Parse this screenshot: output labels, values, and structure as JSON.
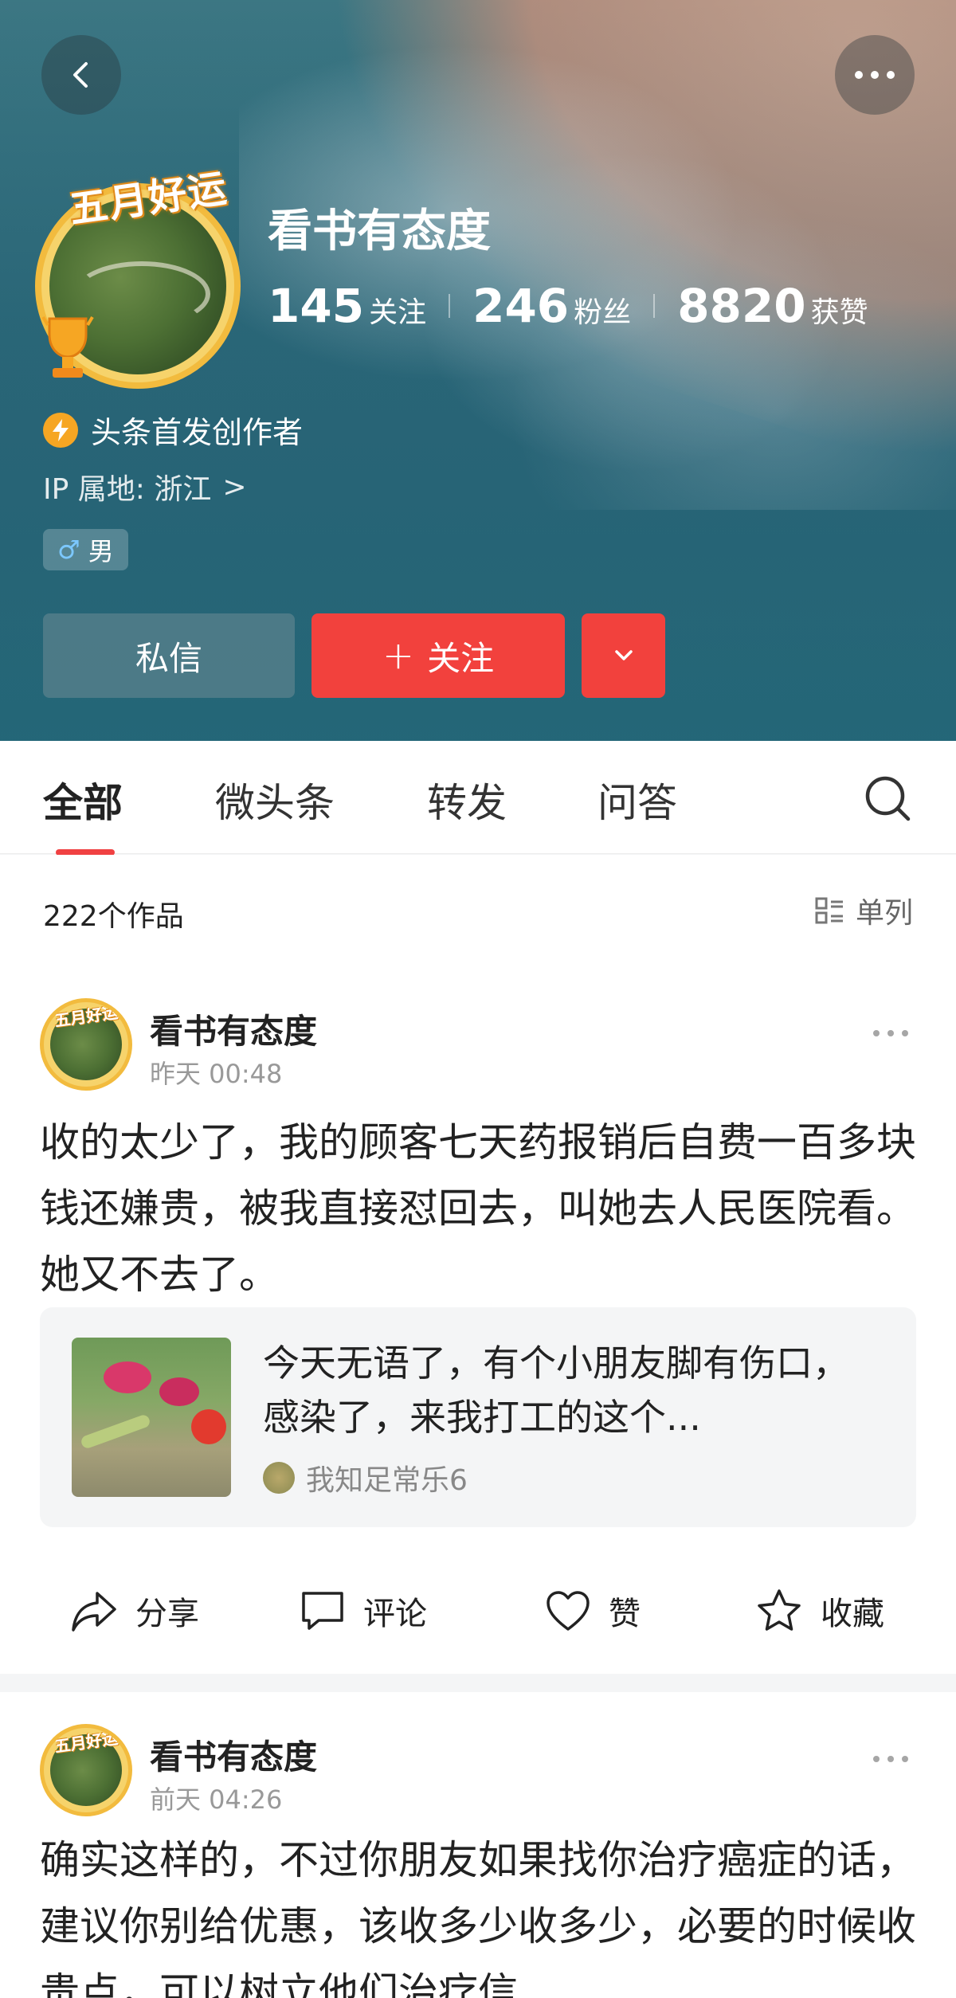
{
  "header": {
    "back_icon": "back-arrow-icon",
    "more_icon": "more-dots-icon",
    "avatar_frame_text": "五月好运",
    "name": "看书有态度",
    "stats": [
      {
        "num": "145",
        "label": "关注"
      },
      {
        "num": "246",
        "label": "粉丝"
      },
      {
        "num": "8820",
        "label": "获赞"
      }
    ],
    "badge_text": "头条首发创作者",
    "ip_text": "IP 属地: 浙江",
    "ip_chevron": ">",
    "gender_icon": "♂",
    "gender_text": "男",
    "message_label": "私信",
    "follow_plus": "+",
    "follow_label": "关注"
  },
  "tabs": {
    "items": [
      {
        "label": "全部",
        "active": true
      },
      {
        "label": "微头条",
        "active": false
      },
      {
        "label": "转发",
        "active": false
      },
      {
        "label": "问答",
        "active": false
      }
    ],
    "accent_color": "#f04142"
  },
  "list_meta": {
    "count_text": "222个作品",
    "layout_label": "单列"
  },
  "posts": [
    {
      "avatar_text": "五月好运",
      "author": "看书有态度",
      "time": "昨天  00:48",
      "body": "收的太少了，我的顾客七天药报销后自费一百多块钱还嫌贵，被我直接怼回去，叫她去人民医院看。她又不去了。",
      "quote": {
        "text": "今天无语了，有个小朋友脚有伤口，感染了，来我打工的这个...",
        "author": "我知足常乐6"
      },
      "actions": [
        {
          "icon": "share-icon",
          "label": "分享"
        },
        {
          "icon": "comment-icon",
          "label": "评论"
        },
        {
          "icon": "heart-icon",
          "label": "赞"
        },
        {
          "icon": "star-icon",
          "label": "收藏"
        }
      ]
    },
    {
      "avatar_text": "五月好运",
      "author": "看书有态度",
      "time": "前天  04:26",
      "body": "确实这样的，不过你朋友如果找你治疗癌症的话，建议你别给优惠，该收多少收多少，必要的时候收贵点，可以树立他们治疗信"
    }
  ],
  "colors": {
    "brand_red": "#f2413d",
    "avatar_gold": "#f2bb3e"
  }
}
